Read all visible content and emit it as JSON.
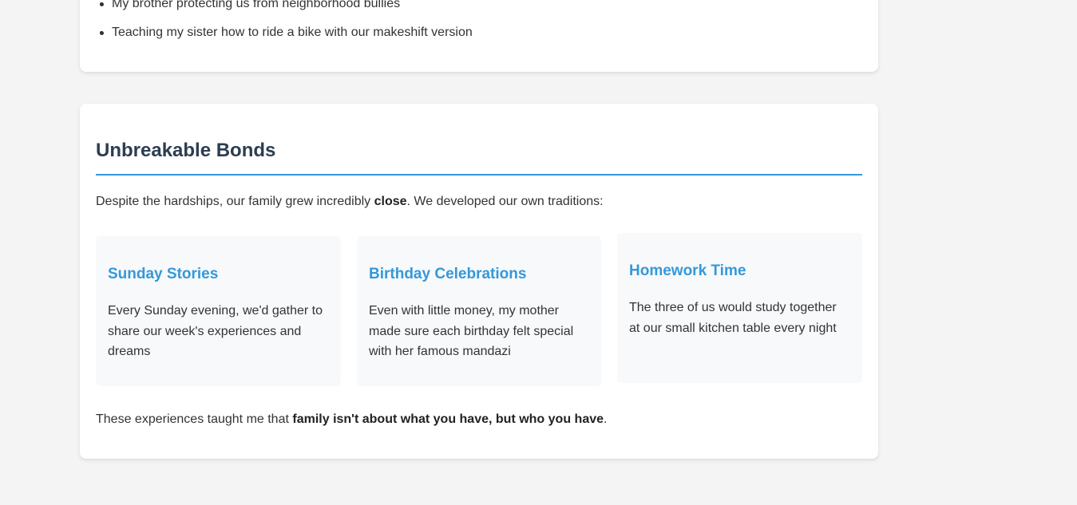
{
  "previous_section": {
    "list_items": [
      "My brother protecting us from neighborhood bullies",
      "Teaching my sister how to ride a bike with our makeshift version"
    ]
  },
  "bonds": {
    "title": "Unbreakable Bonds",
    "intro_before": "Despite the hardships, our family grew incredibly ",
    "intro_bold": "close",
    "intro_after": ". We developed our own traditions:",
    "traditions": [
      {
        "title": "Sunday Stories",
        "text": "Every Sunday evening, we'd gather to share our week's experiences and dreams"
      },
      {
        "title": "Birthday Celebrations",
        "text": "Even with little money, my mother made sure each birthday felt special with her famous mandazi"
      },
      {
        "title": "Homework Time",
        "text": "The three of us would study together at our small kitchen table every night"
      }
    ],
    "closing_before": "These experiences taught me that ",
    "closing_bold": "family isn't about what you have, but who you have",
    "closing_after": "."
  },
  "colors": {
    "page_background": "#f4f4f4",
    "card_background": "#ffffff",
    "heading": "#2c3e50",
    "accent": "#3498db",
    "tradition_background": "#f8f9fa",
    "text": "#333333"
  }
}
